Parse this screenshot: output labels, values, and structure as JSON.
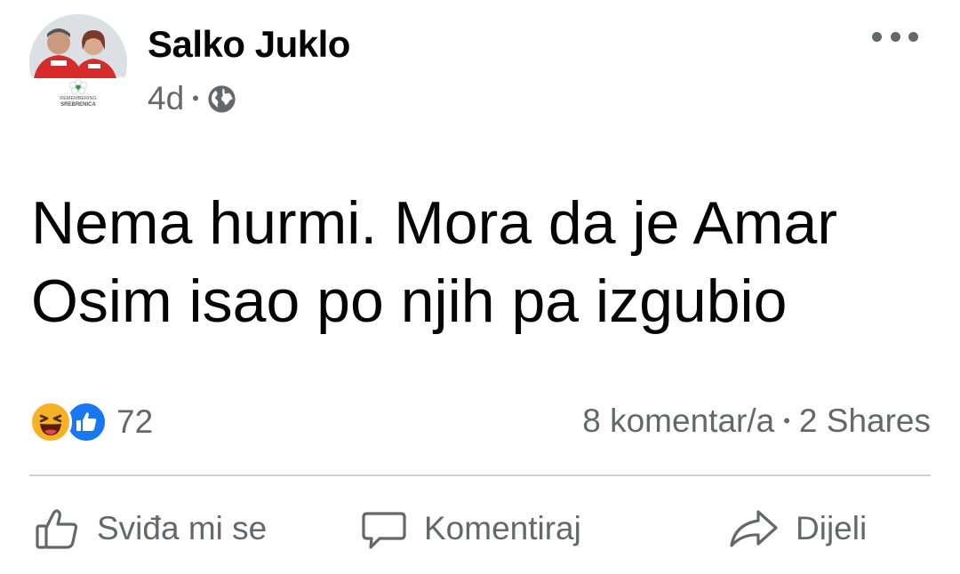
{
  "post": {
    "author": "Salko Juklo",
    "time": "4d",
    "meta_separator": "•",
    "privacy_icon": "globe-icon",
    "text_lines": [
      "Nema hurmi. Mora da je Amar",
      "Osim isao po njih pa izgubio"
    ],
    "avatar_badge_text": [
      "REMEMBERING",
      "SREBRENICA"
    ]
  },
  "stats": {
    "reaction_icons": [
      "haha-reaction-icon",
      "like-reaction-icon"
    ],
    "reaction_count": "72",
    "comments": "8 komentar/a",
    "separator": "•",
    "shares": "2 Shares"
  },
  "actions": {
    "like_label": "Sviđa mi se",
    "comment_label": "Komentiraj",
    "share_label": "Dijeli"
  },
  "colors": {
    "text": "#050505",
    "secondary": "#65676b",
    "like_blue": "#1877f2",
    "haha_yellow": "#f7b125",
    "divider": "#ced0d4"
  }
}
